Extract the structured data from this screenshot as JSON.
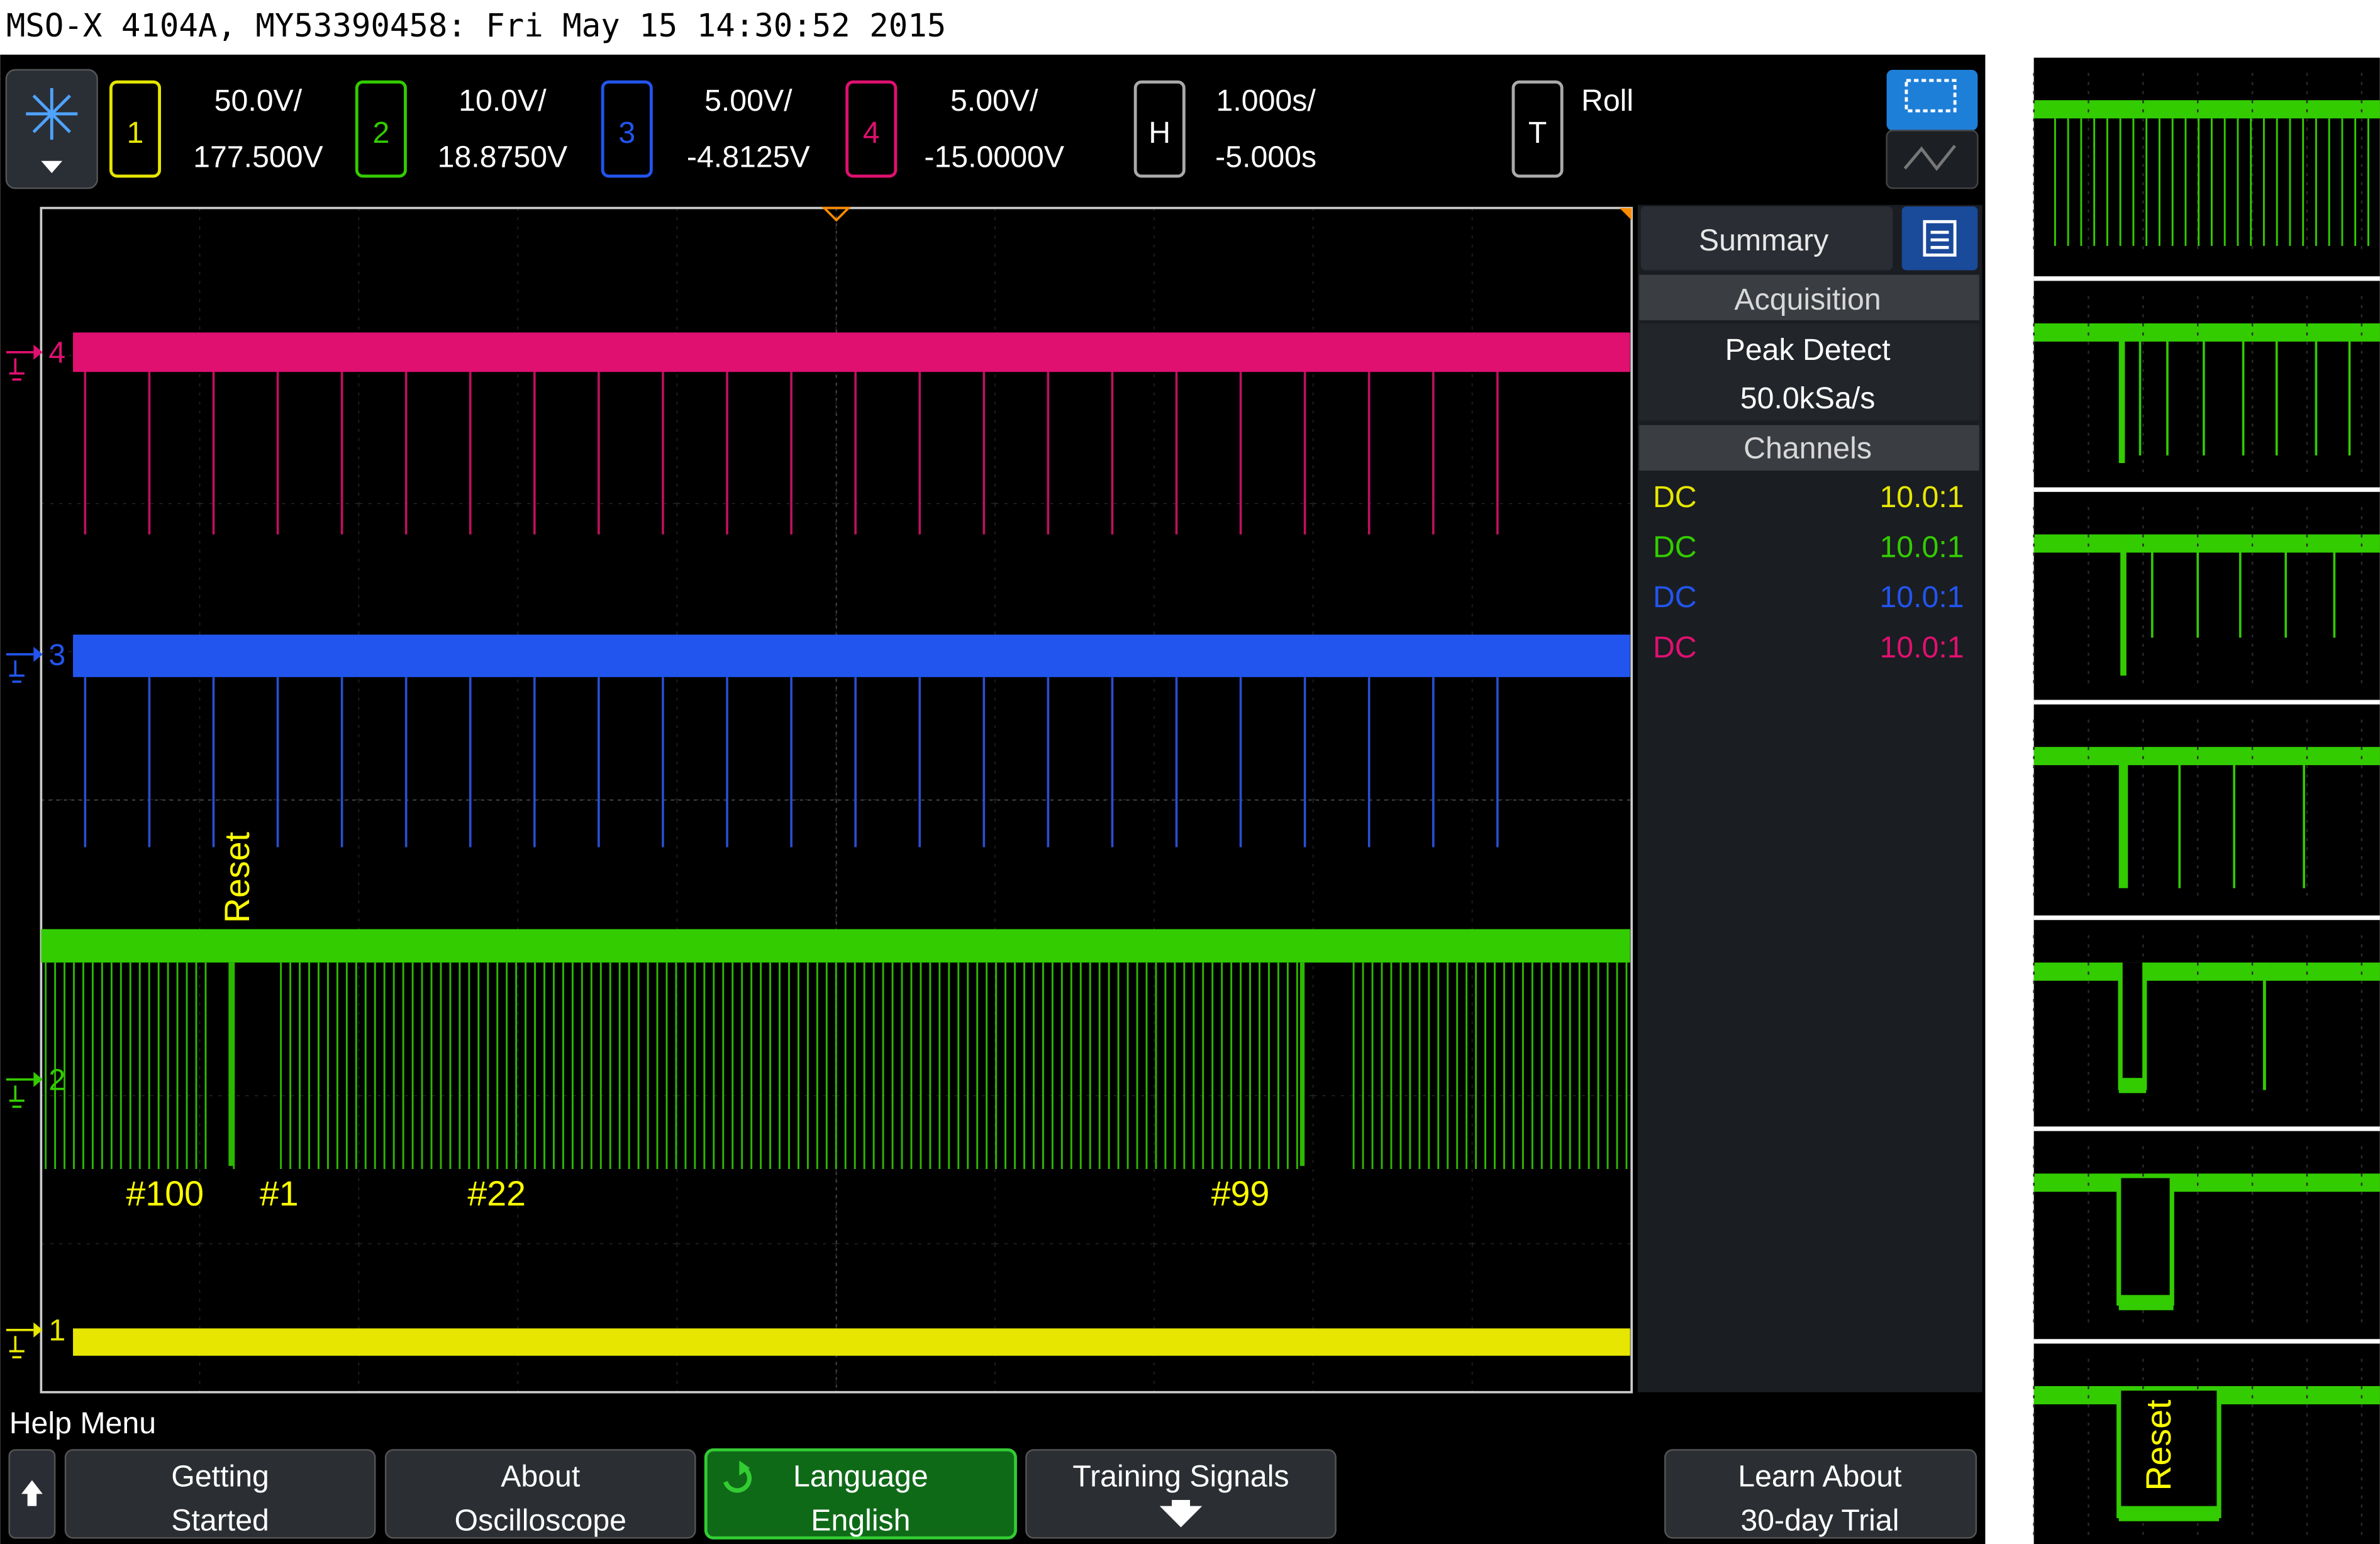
{
  "window_title": "MSO-X 4104A, MY53390458: Fri May 15 14:30:52 2015",
  "channels": [
    {
      "num": "1",
      "scale": "50.0V/",
      "offset": "177.500V",
      "color": "#e6e600"
    },
    {
      "num": "2",
      "scale": "10.0V/",
      "offset": "18.8750V",
      "color": "#33cc00"
    },
    {
      "num": "3",
      "scale": "5.00V/",
      "offset": "-4.8125V",
      "color": "#2255ee"
    },
    {
      "num": "4",
      "scale": "5.00V/",
      "offset": "-15.0000V",
      "color": "#e01070"
    }
  ],
  "horizontal": {
    "key": "H",
    "scale": "1.000s/",
    "delay": "-5.000s"
  },
  "trigger": {
    "key": "T",
    "mode": "Roll"
  },
  "waveform_labels": {
    "ch4_marker": "4",
    "ch3_marker": "3",
    "ch2_marker": "2",
    "ch1_marker": "1",
    "reset": "Reset",
    "n100": "#100",
    "n1": "#1",
    "n22": "#22",
    "n99": "#99"
  },
  "sidebar": {
    "tab": "Summary",
    "acquisition_header": "Acquisition",
    "acq_mode": "Peak Detect",
    "sample_rate": "50.0kSa/s",
    "channels_header": "Channels",
    "channel_rows": [
      {
        "coupling": "DC",
        "probe": "10.0:1",
        "color": "#e6e600"
      },
      {
        "coupling": "DC",
        "probe": "10.0:1",
        "color": "#33cc00"
      },
      {
        "coupling": "DC",
        "probe": "10.0:1",
        "color": "#2255ee"
      },
      {
        "coupling": "DC",
        "probe": "10.0:1",
        "color": "#e01070"
      }
    ]
  },
  "help_menu": {
    "title": "Help Menu",
    "buttons": [
      {
        "line1": "Getting",
        "line2": "Started"
      },
      {
        "line1": "About",
        "line2": "Oscilloscope"
      },
      {
        "line1": "Language",
        "line2": "English"
      },
      {
        "line1": "Training Signals",
        "line2": ""
      },
      {
        "line1": "Learn About",
        "line2": "30-day Trial"
      }
    ]
  },
  "zoom_panel": {
    "reset_label": "Reset"
  }
}
